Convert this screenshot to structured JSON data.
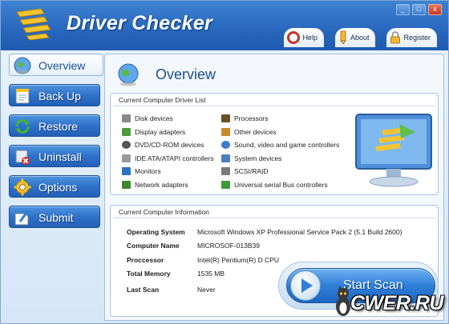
{
  "app": {
    "title": "Driver Checker"
  },
  "window_controls": {
    "minimize": "_",
    "maximize": "□",
    "close": "x"
  },
  "top_links": [
    {
      "label": "Help",
      "icon": "help-lifebuoy-icon"
    },
    {
      "label": "About",
      "icon": "pencil-icon"
    },
    {
      "label": "Register",
      "icon": "lock-icon"
    }
  ],
  "sidebar": {
    "items": [
      {
        "label": "Overview",
        "icon": "globe-icon",
        "active": true
      },
      {
        "label": "Back Up",
        "icon": "document-icon",
        "active": false
      },
      {
        "label": "Restore",
        "icon": "refresh-icon",
        "active": false
      },
      {
        "label": "Uninstall",
        "icon": "uninstall-icon",
        "active": false
      },
      {
        "label": "Options",
        "icon": "gear-icon",
        "active": false
      },
      {
        "label": "Submit",
        "icon": "upload-icon",
        "active": false
      }
    ]
  },
  "main": {
    "title": "Overview",
    "driver_list": {
      "title": "Current Computer Driver List",
      "left": [
        {
          "label": "Disk devices",
          "color": "#8a8a8a"
        },
        {
          "label": "Display adapters",
          "color": "#4f9a3c"
        },
        {
          "label": "DVD/CD-ROM devices",
          "color": "#555555"
        },
        {
          "label": "IDE ATA/ATAPI controllers",
          "color": "#9a9a9a"
        },
        {
          "label": "Monitors",
          "color": "#2f6fc4"
        },
        {
          "label": "Network adapters",
          "color": "#3b8a2e"
        }
      ],
      "right": [
        {
          "label": "Processors",
          "color": "#6b4f2a"
        },
        {
          "label": "Other devices",
          "color": "#c98a2a"
        },
        {
          "label": "Sound, video and game controllers",
          "color": "#3b7bd0"
        },
        {
          "label": "System devices",
          "color": "#4a7fc0"
        },
        {
          "label": "SCSI/RAID",
          "color": "#7a7a7a"
        },
        {
          "label": "Universal serial Bus controllers",
          "color": "#3a9a3a"
        }
      ]
    },
    "info": {
      "title": "Current Computer Information",
      "rows": [
        {
          "key": "Operating System",
          "value": "Microsoft Windows XP Professional Service Pack 2 (5.1 Build 2600)"
        },
        {
          "key": "Computer Name",
          "value": "MICROSOF-013B39"
        },
        {
          "key": "Proccessor",
          "value": "Intel(R) Pentium(R) D CPU"
        },
        {
          "key": "Total Memory",
          "value": "1535 MB"
        },
        {
          "key": "Last Scan",
          "value": "Never"
        }
      ]
    },
    "scan_button": {
      "label": "Start Scan"
    }
  },
  "watermark": {
    "text": "CWER.RU"
  },
  "colors": {
    "accent": "#2a69bf",
    "title_text": "#1c4e8e"
  }
}
